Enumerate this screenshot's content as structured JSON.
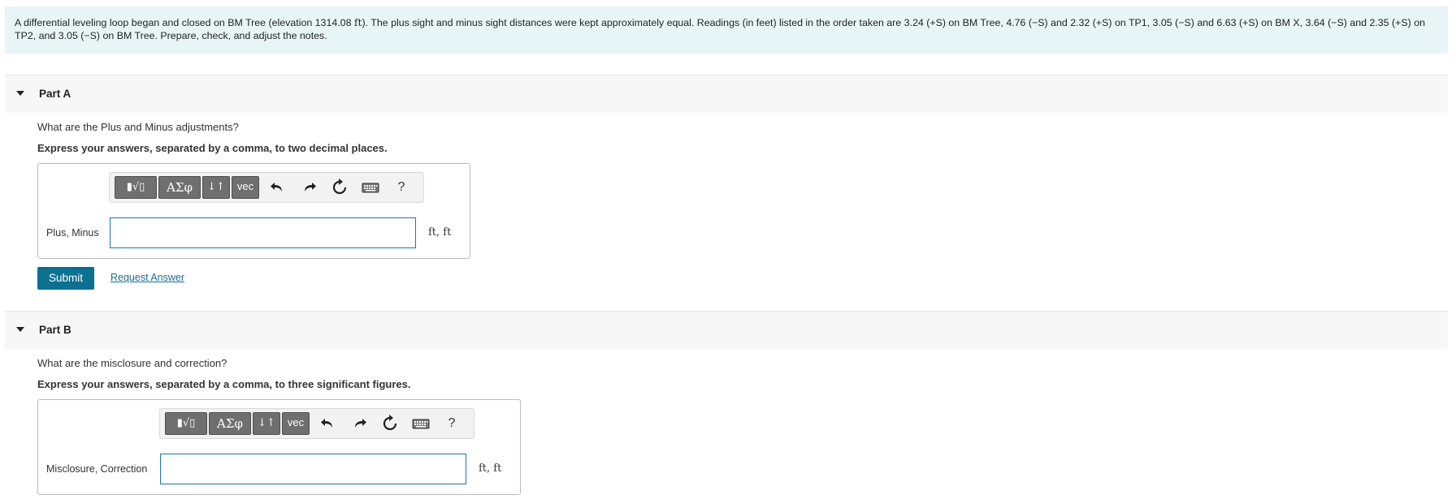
{
  "problem": {
    "text_before": "A differential leveling loop began and closed on BM Tree (elevation 1314.08 ",
    "unit": "ft",
    "text_after": "). The plus sight and minus sight distances were kept approximately equal. Readings (in feet) listed in the order taken are 3.24 (+S) on BM Tree, 4.76 (−S) and 2.32 (+S) on TP1, 3.05 (−S) and 6.63 (+S) on BM X, 3.64 (−S) and 2.35 (+S) on TP2, and 3.05 (−S) on BM Tree. Prepare, check, and adjust the notes."
  },
  "toolbar": {
    "templates_label": "▮√▯",
    "greek_label": "ΑΣφ",
    "updown_label": "↓↑",
    "vec_label": "vec",
    "undo_icon": "undo-icon",
    "redo_icon": "redo-icon",
    "reset_icon": "reset-icon",
    "keyboard_icon": "keyboard-icon",
    "help_label": "?"
  },
  "part_a": {
    "title": "Part A",
    "question": "What are the Plus and Minus adjustments?",
    "instruction": "Express your answers, separated by a comma, to two decimal places.",
    "label": "Plus, Minus",
    "value": "",
    "units": "ft, ft",
    "submit_label": "Submit",
    "request_label": "Request Answer"
  },
  "part_b": {
    "title": "Part B",
    "question": "What are the misclosure and correction?",
    "instruction": "Express your answers, separated by a comma, to three significant figures.",
    "label": "Misclosure, Correction",
    "value": "",
    "units": "ft, ft"
  },
  "colors": {
    "problem_bg": "#e8f5f7",
    "accent": "#0b7191",
    "link": "#1b6c93",
    "input_border": "#1a7a9e"
  }
}
